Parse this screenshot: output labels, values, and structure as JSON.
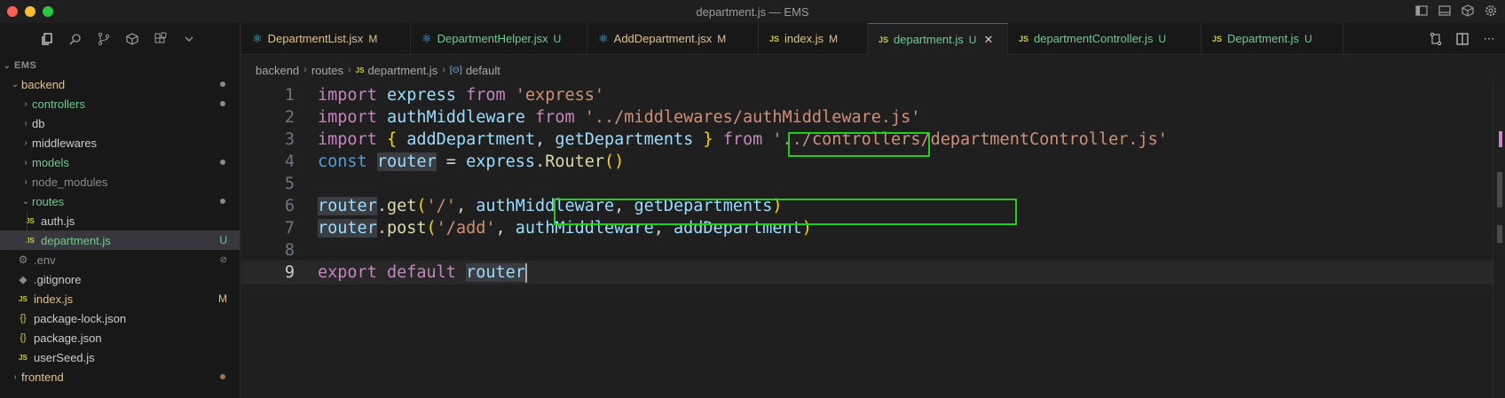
{
  "window": {
    "title": "department.js — EMS"
  },
  "sidebar": {
    "section_title": "EMS",
    "items": [
      {
        "label": "backend",
        "type": "folder",
        "open": true,
        "depth": 0
      },
      {
        "label": "controllers",
        "type": "folder",
        "open": false,
        "depth": 1
      },
      {
        "label": "db",
        "type": "folder",
        "open": false,
        "depth": 1
      },
      {
        "label": "middlewares",
        "type": "folder",
        "open": false,
        "depth": 1
      },
      {
        "label": "models",
        "type": "folder",
        "open": false,
        "depth": 1
      },
      {
        "label": "node_modules",
        "type": "folder",
        "open": false,
        "depth": 1
      },
      {
        "label": "routes",
        "type": "folder",
        "open": true,
        "depth": 1
      },
      {
        "label": "auth.js",
        "type": "js",
        "depth": 2
      },
      {
        "label": "department.js",
        "type": "js",
        "depth": 2,
        "badge": "U"
      },
      {
        "label": ".env",
        "type": "gear",
        "depth": 1
      },
      {
        "label": ".gitignore",
        "type": "dot",
        "depth": 1
      },
      {
        "label": "index.js",
        "type": "js",
        "depth": 1,
        "badge": "M"
      },
      {
        "label": "package-lock.json",
        "type": "json",
        "depth": 1
      },
      {
        "label": "package.json",
        "type": "json",
        "depth": 1
      },
      {
        "label": "userSeed.js",
        "type": "js",
        "depth": 1
      },
      {
        "label": "frontend",
        "type": "folder",
        "open": false,
        "depth": 0
      }
    ]
  },
  "tabs": [
    {
      "label": "DepartmentList.jsx",
      "status": "M",
      "icon": "react"
    },
    {
      "label": "DepartmentHelper.jsx",
      "status": "U",
      "icon": "react"
    },
    {
      "label": "AddDepartment.jsx",
      "status": "M",
      "icon": "react"
    },
    {
      "label": "index.js",
      "status": "M",
      "icon": "js"
    },
    {
      "label": "department.js",
      "status": "U",
      "icon": "js",
      "active": true
    },
    {
      "label": "departmentController.js",
      "status": "U",
      "icon": "js"
    },
    {
      "label": "Department.js",
      "status": "U",
      "icon": "js"
    }
  ],
  "breadcrumb": {
    "parts": [
      "backend",
      "routes",
      "department.js",
      "default"
    ],
    "js_tag": "JS"
  },
  "editor": {
    "line_numbers": [
      "1",
      "2",
      "3",
      "4",
      "5",
      "6",
      "7",
      "8",
      "9"
    ],
    "active_line": "9",
    "lines": {
      "l1": {
        "a": "import",
        "b": " express ",
        "c": "from",
        "d": " 'express'"
      },
      "l2": {
        "a": "import",
        "b": " authMiddleware ",
        "c": "from",
        "d": " '../middlewares/authMiddleware.js'"
      },
      "l3": {
        "a": "import",
        "b": " { ",
        "c": "addDepartment",
        "d": ", ",
        "e": "getDepartments",
        "f": " } ",
        "g": "from",
        "h": " '../controllers/departmentController.js'"
      },
      "l4": {
        "a": "const",
        "b": " ",
        "c": "router",
        "d": " = ",
        "e": "express",
        "f": ".",
        "g": "Router",
        "h": "()"
      },
      "l6": {
        "a": "router",
        "b": ".",
        "c": "get",
        "d": "(",
        "e": "'/'",
        "f": ", ",
        "g": "authMiddleware",
        "h": ", ",
        "i": "getDepartments",
        "j": ")"
      },
      "l7": {
        "a": "router",
        "b": ".",
        "c": "post",
        "d": "(",
        "e": "'/add'",
        "f": ", ",
        "g": "authMiddleware",
        "h": ", ",
        "i": "addDepartment",
        "j": ")"
      },
      "l9": {
        "a": "export",
        "b": " ",
        "c": "default",
        "d": " ",
        "e": "router"
      }
    }
  },
  "colors": {
    "accent": "#0078d4",
    "highlight_box": "#22cc22",
    "untracked": "#73c991",
    "modified": "#e2c08d"
  }
}
